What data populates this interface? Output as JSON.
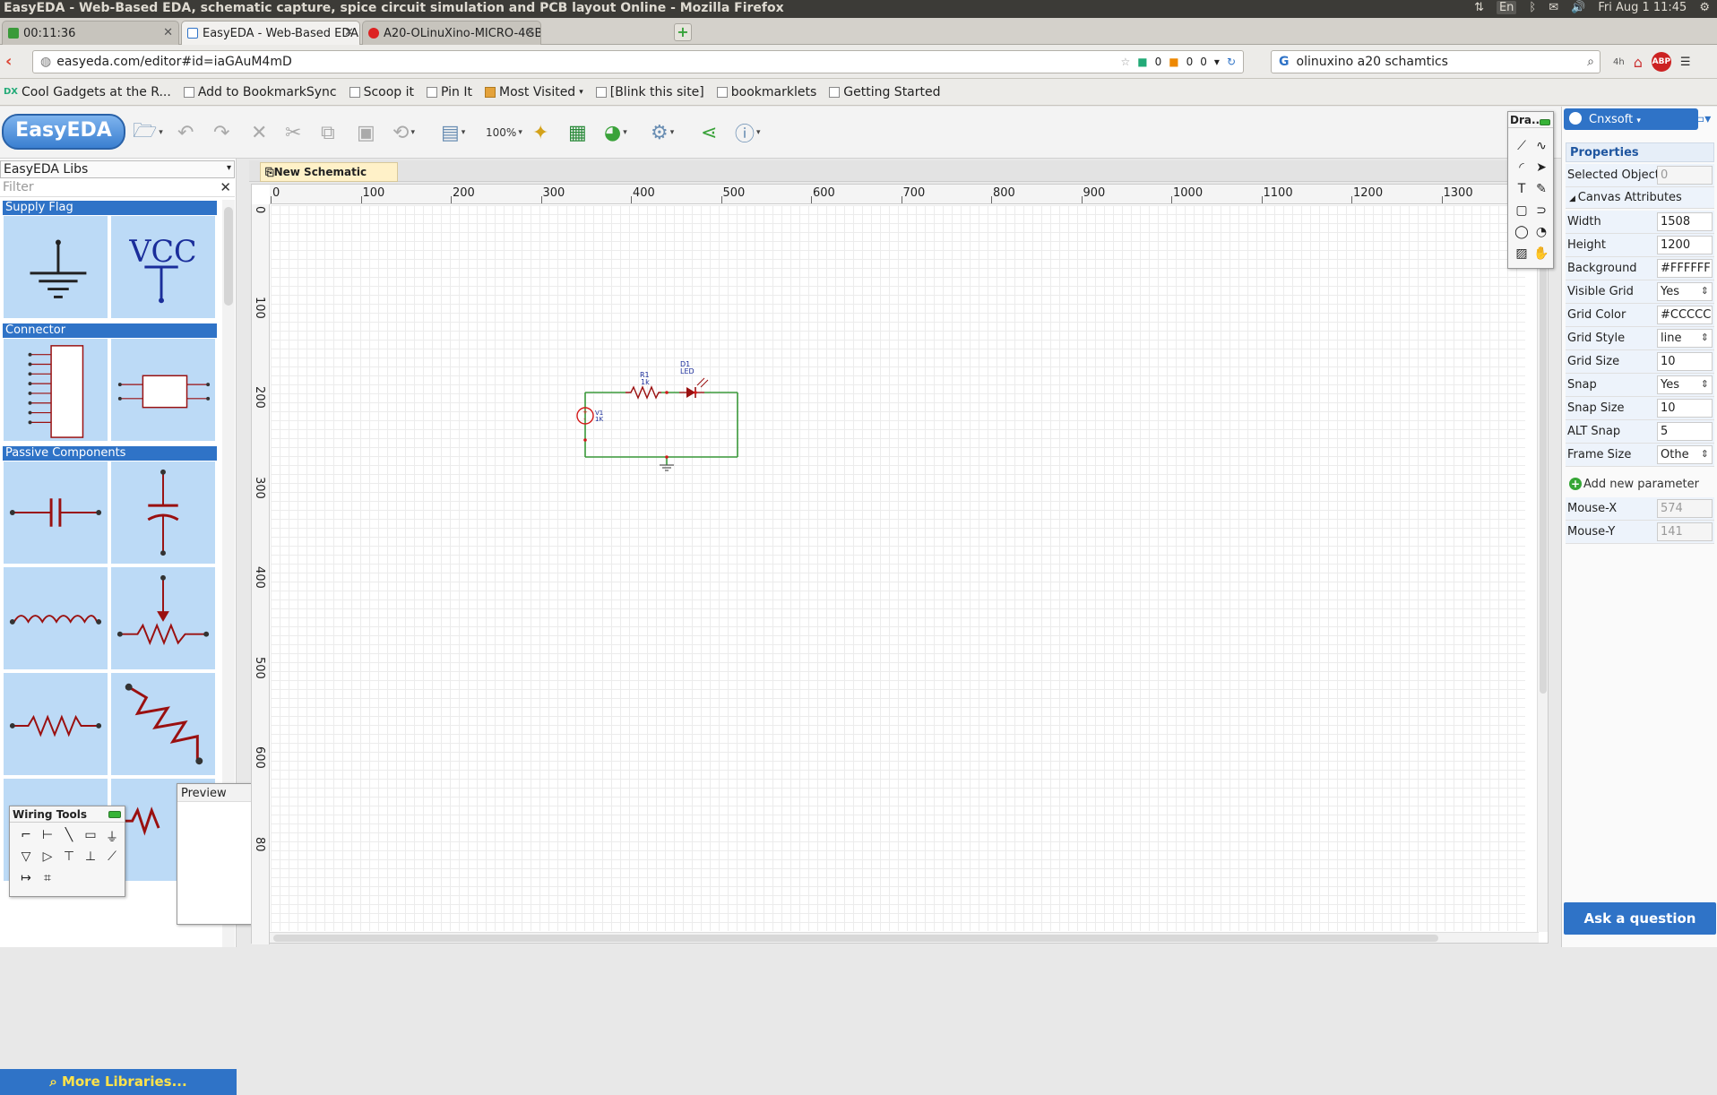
{
  "os": {
    "window_title": "EasyEDA - Web-Based EDA, schematic capture, spice circuit simulation and PCB layout Online - Mozilla Firefox",
    "lang": "En",
    "clock": "Fri Aug 1 11:45"
  },
  "browser": {
    "tabs": [
      {
        "label": "00:11:36"
      },
      {
        "label": "EasyEDA - Web-Based EDA, ..."
      },
      {
        "label": "A20-OLinuXino-MICRO-4GB ..."
      }
    ],
    "url": "easyeda.com/editor#id=iaGAuM4mD",
    "url_counters": [
      "0",
      "0",
      "0"
    ],
    "search_query": "olinuxino a20 schamtics",
    "nav_time": "4h",
    "abp_label": "ABP",
    "bookmarks": [
      "Cool Gadgets at the R...",
      "Add to BookmarkSync",
      "Scoop it",
      "Pin It",
      "Most Visited",
      "[Blink this site]",
      "bookmarklets",
      "Getting Started"
    ]
  },
  "app": {
    "logo": "EasyEDA",
    "zoom": "100%",
    "lib_select": "EasyEDA Libs",
    "filter_placeholder": "Filter",
    "categories": [
      "Supply Flag",
      "Connector",
      "Passive Components"
    ],
    "vcc_label": "VCC",
    "more_libraries": "More Libraries...",
    "wiring_title": "Wiring Tools",
    "preview_title": "Preview",
    "doc_tab": "New Schematic",
    "draw_title": "Dra...",
    "ruler_x": [
      "0",
      "100",
      "200",
      "300",
      "400",
      "500",
      "600",
      "700",
      "800",
      "900",
      "1000",
      "1100",
      "1200",
      "1300"
    ],
    "ruler_y": [
      "0",
      "100",
      "200",
      "300",
      "400",
      "500",
      "600",
      "80"
    ],
    "schematic": {
      "r1": {
        "ref": "R1",
        "value": "1k"
      },
      "d1": {
        "ref": "D1",
        "value": "LED"
      },
      "v1": {
        "ref": "V1",
        "value": "1K"
      }
    }
  },
  "props": {
    "user": "Cnxsoft",
    "title": "Properties",
    "selected_objects_label": "Selected Objects",
    "selected_objects_value": "0",
    "canvas_attributes": "Canvas Attributes",
    "rows": [
      {
        "k": "Width",
        "v": "1508"
      },
      {
        "k": "Height",
        "v": "1200"
      },
      {
        "k": "Background",
        "v": "#FFFFFF"
      },
      {
        "k": "Visible Grid",
        "v": "Yes"
      },
      {
        "k": "Grid Color",
        "v": "#CCCCCC"
      },
      {
        "k": "Grid Style",
        "v": "line"
      },
      {
        "k": "Grid Size",
        "v": "10"
      },
      {
        "k": "Snap",
        "v": "Yes"
      },
      {
        "k": "Snap Size",
        "v": "10"
      },
      {
        "k": "ALT Snap",
        "v": "5"
      },
      {
        "k": "Frame Size",
        "v": "Othe"
      }
    ],
    "add_param": "Add new parameter",
    "mouse_x_label": "Mouse-X",
    "mouse_x": "574",
    "mouse_y_label": "Mouse-Y",
    "mouse_y": "141",
    "ask": "Ask a question"
  }
}
